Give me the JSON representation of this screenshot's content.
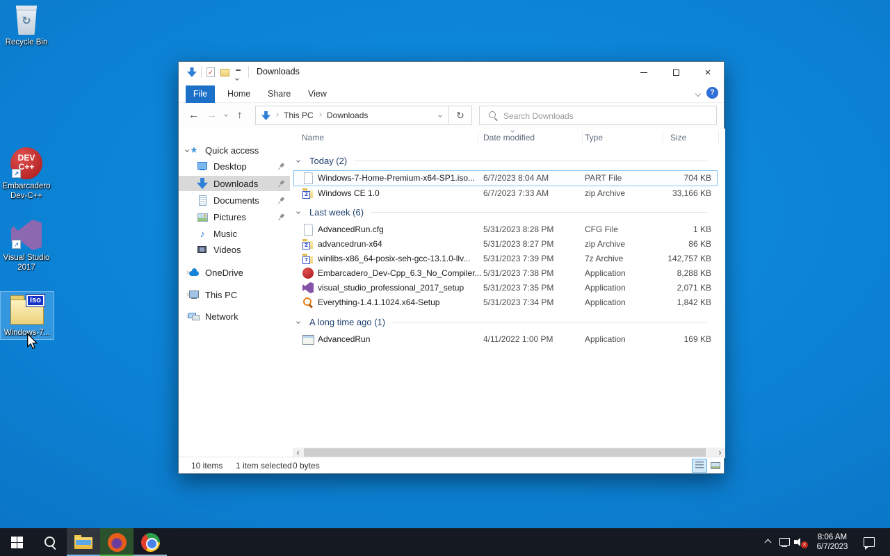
{
  "desktop": {
    "icons": [
      {
        "label": "Recycle Bin",
        "icon": "recycle-bin-icon",
        "selected": false
      },
      {
        "label_line1": "Embarcadero",
        "label_line2": "Dev-C++",
        "icon": "devcpp-icon",
        "badge_line1": "DEV",
        "badge_line2": "C++",
        "shortcut_glyph": "↗",
        "selected": false
      },
      {
        "label_line1": "Visual Studio",
        "label_line2": "2017",
        "icon": "visual-studio-icon",
        "shortcut_glyph": "↗",
        "selected": false
      },
      {
        "label": "Windows-7...",
        "icon": "iso-folder-icon",
        "badge": "iso",
        "selected": true
      }
    ]
  },
  "explorer": {
    "title": "Downloads",
    "ribbon": {
      "tabs": [
        "File",
        "Home",
        "Share",
        "View"
      ]
    },
    "nav": {
      "breadcrumb": [
        "This PC",
        "Downloads"
      ],
      "search_placeholder": "Search Downloads",
      "back_glyph": "←",
      "forward_glyph": "→",
      "up_glyph": "↑",
      "refresh_glyph": "↻"
    },
    "columns": {
      "name": "Name",
      "date": "Date modified",
      "type": "Type",
      "size": "Size",
      "sorted_by": "Date modified",
      "sort_direction": "descending"
    },
    "sidebar": [
      {
        "label": "Quick access",
        "icon": "quick-access-star-icon",
        "expanded": true
      },
      {
        "label": "Desktop",
        "icon": "desktop-monitor-icon",
        "pinned": true
      },
      {
        "label": "Downloads",
        "icon": "downloads-arrow-icon",
        "pinned": true,
        "selected": true
      },
      {
        "label": "Documents",
        "icon": "documents-icon",
        "pinned": true
      },
      {
        "label": "Pictures",
        "icon": "pictures-icon",
        "pinned": true
      },
      {
        "label": "Music",
        "icon": "music-note-icon"
      },
      {
        "label": "Videos",
        "icon": "videos-icon"
      },
      {
        "label": "OneDrive",
        "icon": "onedrive-cloud-icon"
      },
      {
        "label": "This PC",
        "icon": "thispc-icon"
      },
      {
        "label": "Network",
        "icon": "network-icon"
      }
    ],
    "groups": [
      {
        "label": "Today (2)"
      },
      {
        "label": "Last week (6)"
      },
      {
        "label": "A long time ago (1)"
      }
    ],
    "files": [
      {
        "name": "Windows-7-Home-Premium-x64-SP1.iso...",
        "date": "6/7/2023 8:04 AM",
        "type": "PART File",
        "size": "704 KB",
        "icon": "doc-file-icon",
        "selected": true
      },
      {
        "name": "Windows CE 1.0",
        "date": "6/7/2023 7:33 AM",
        "type": "zip Archive",
        "size": "33,166 KB",
        "icon": "zip-folder-icon"
      },
      {
        "name": "AdvancedRun.cfg",
        "date": "5/31/2023 8:28 PM",
        "type": "CFG File",
        "size": "1 KB",
        "icon": "doc-file-icon"
      },
      {
        "name": "advancedrun-x64",
        "date": "5/31/2023 8:27 PM",
        "type": "zip Archive",
        "size": "86 KB",
        "icon": "zip-folder-icon"
      },
      {
        "name": "winlibs-x86_64-posix-seh-gcc-13.1.0-llv...",
        "date": "5/31/2023 7:39 PM",
        "type": "7z Archive",
        "size": "142,757 KB",
        "icon": "sevenzip-folder-icon"
      },
      {
        "name": "Embarcadero_Dev-Cpp_6.3_No_Compiler...",
        "date": "5/31/2023 7:38 PM",
        "type": "Application",
        "size": "8,288 KB",
        "icon": "devcpp-icon"
      },
      {
        "name": "visual_studio_professional_2017_setup",
        "date": "5/31/2023 7:35 PM",
        "type": "Application",
        "size": "2,071 KB",
        "icon": "vs-installer-icon"
      },
      {
        "name": "Everything-1.4.1.1024.x64-Setup",
        "date": "5/31/2023 7:34 PM",
        "type": "Application",
        "size": "1,842 KB",
        "icon": "everything-icon"
      },
      {
        "name": "AdvancedRun",
        "date": "4/11/2022 1:00 PM",
        "type": "Application",
        "size": "169 KB",
        "icon": "appwindow-icon"
      }
    ],
    "status": {
      "items": "10 items",
      "selected": "1 item selected",
      "bytes": "0 bytes"
    }
  },
  "taskbar": {
    "clock": {
      "time": "8:06 AM",
      "date": "6/7/2023"
    }
  }
}
